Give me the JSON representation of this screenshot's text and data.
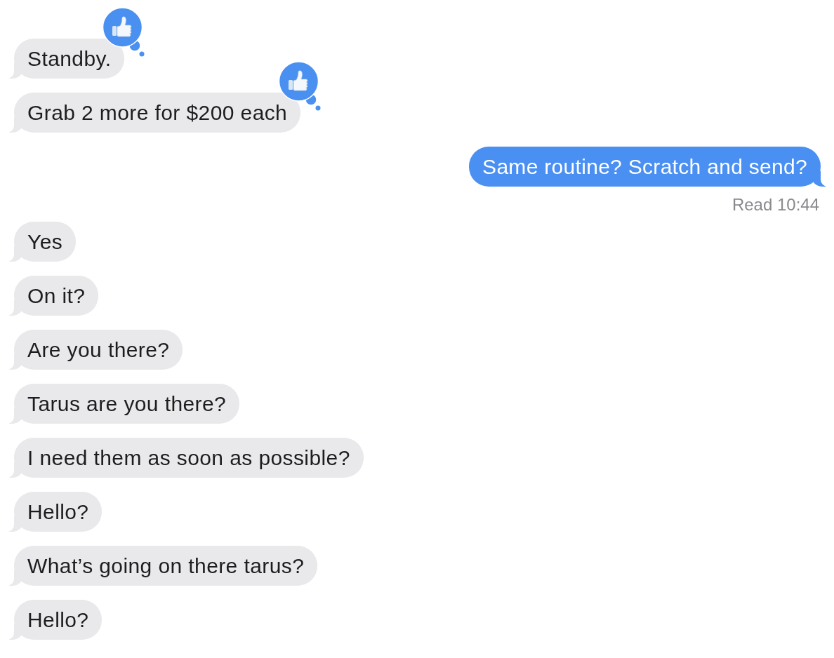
{
  "messages": [
    {
      "kind": "received",
      "text": "Standby.",
      "liked": true
    },
    {
      "kind": "received",
      "text": "Grab 2 more for $200 each",
      "liked": true
    },
    {
      "kind": "sent",
      "text": "Same routine? Scratch and send?",
      "liked": false,
      "receipt": "Read 10:44"
    },
    {
      "kind": "received",
      "text": "Yes",
      "liked": false
    },
    {
      "kind": "received",
      "text": "On it?",
      "liked": false
    },
    {
      "kind": "received",
      "text": "Are you there?",
      "liked": false
    },
    {
      "kind": "received",
      "text": "Tarus are you there?",
      "liked": false
    },
    {
      "kind": "received",
      "text": "I need them as soon as possible?",
      "liked": false
    },
    {
      "kind": "received",
      "text": "Hello?",
      "liked": false
    },
    {
      "kind": "received",
      "text": "What’s going on there tarus?",
      "liked": false
    },
    {
      "kind": "received",
      "text": "Hello?",
      "liked": false
    }
  ]
}
